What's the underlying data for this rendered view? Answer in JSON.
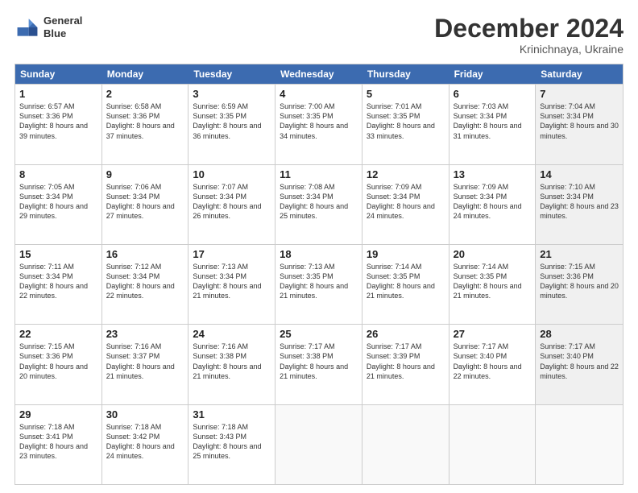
{
  "logo": {
    "line1": "General",
    "line2": "Blue"
  },
  "title": "December 2024",
  "subtitle": "Krinichnaya, Ukraine",
  "days_of_week": [
    "Sunday",
    "Monday",
    "Tuesday",
    "Wednesday",
    "Thursday",
    "Friday",
    "Saturday"
  ],
  "weeks": [
    [
      {
        "day": 1,
        "sunrise": "6:57 AM",
        "sunset": "3:36 PM",
        "daylight": "8 hours and 39 minutes.",
        "shaded": false
      },
      {
        "day": 2,
        "sunrise": "6:58 AM",
        "sunset": "3:36 PM",
        "daylight": "8 hours and 37 minutes.",
        "shaded": false
      },
      {
        "day": 3,
        "sunrise": "6:59 AM",
        "sunset": "3:35 PM",
        "daylight": "8 hours and 36 minutes.",
        "shaded": false
      },
      {
        "day": 4,
        "sunrise": "7:00 AM",
        "sunset": "3:35 PM",
        "daylight": "8 hours and 34 minutes.",
        "shaded": false
      },
      {
        "day": 5,
        "sunrise": "7:01 AM",
        "sunset": "3:35 PM",
        "daylight": "8 hours and 33 minutes.",
        "shaded": false
      },
      {
        "day": 6,
        "sunrise": "7:03 AM",
        "sunset": "3:34 PM",
        "daylight": "8 hours and 31 minutes.",
        "shaded": false
      },
      {
        "day": 7,
        "sunrise": "7:04 AM",
        "sunset": "3:34 PM",
        "daylight": "8 hours and 30 minutes.",
        "shaded": true
      }
    ],
    [
      {
        "day": 8,
        "sunrise": "7:05 AM",
        "sunset": "3:34 PM",
        "daylight": "8 hours and 29 minutes.",
        "shaded": false
      },
      {
        "day": 9,
        "sunrise": "7:06 AM",
        "sunset": "3:34 PM",
        "daylight": "8 hours and 27 minutes.",
        "shaded": false
      },
      {
        "day": 10,
        "sunrise": "7:07 AM",
        "sunset": "3:34 PM",
        "daylight": "8 hours and 26 minutes.",
        "shaded": false
      },
      {
        "day": 11,
        "sunrise": "7:08 AM",
        "sunset": "3:34 PM",
        "daylight": "8 hours and 25 minutes.",
        "shaded": false
      },
      {
        "day": 12,
        "sunrise": "7:09 AM",
        "sunset": "3:34 PM",
        "daylight": "8 hours and 24 minutes.",
        "shaded": false
      },
      {
        "day": 13,
        "sunrise": "7:09 AM",
        "sunset": "3:34 PM",
        "daylight": "8 hours and 24 minutes.",
        "shaded": false
      },
      {
        "day": 14,
        "sunrise": "7:10 AM",
        "sunset": "3:34 PM",
        "daylight": "8 hours and 23 minutes.",
        "shaded": true
      }
    ],
    [
      {
        "day": 15,
        "sunrise": "7:11 AM",
        "sunset": "3:34 PM",
        "daylight": "8 hours and 22 minutes.",
        "shaded": false
      },
      {
        "day": 16,
        "sunrise": "7:12 AM",
        "sunset": "3:34 PM",
        "daylight": "8 hours and 22 minutes.",
        "shaded": false
      },
      {
        "day": 17,
        "sunrise": "7:13 AM",
        "sunset": "3:34 PM",
        "daylight": "8 hours and 21 minutes.",
        "shaded": false
      },
      {
        "day": 18,
        "sunrise": "7:13 AM",
        "sunset": "3:35 PM",
        "daylight": "8 hours and 21 minutes.",
        "shaded": false
      },
      {
        "day": 19,
        "sunrise": "7:14 AM",
        "sunset": "3:35 PM",
        "daylight": "8 hours and 21 minutes.",
        "shaded": false
      },
      {
        "day": 20,
        "sunrise": "7:14 AM",
        "sunset": "3:35 PM",
        "daylight": "8 hours and 21 minutes.",
        "shaded": false
      },
      {
        "day": 21,
        "sunrise": "7:15 AM",
        "sunset": "3:36 PM",
        "daylight": "8 hours and 20 minutes.",
        "shaded": true
      }
    ],
    [
      {
        "day": 22,
        "sunrise": "7:15 AM",
        "sunset": "3:36 PM",
        "daylight": "8 hours and 20 minutes.",
        "shaded": false
      },
      {
        "day": 23,
        "sunrise": "7:16 AM",
        "sunset": "3:37 PM",
        "daylight": "8 hours and 21 minutes.",
        "shaded": false
      },
      {
        "day": 24,
        "sunrise": "7:16 AM",
        "sunset": "3:38 PM",
        "daylight": "8 hours and 21 minutes.",
        "shaded": false
      },
      {
        "day": 25,
        "sunrise": "7:17 AM",
        "sunset": "3:38 PM",
        "daylight": "8 hours and 21 minutes.",
        "shaded": false
      },
      {
        "day": 26,
        "sunrise": "7:17 AM",
        "sunset": "3:39 PM",
        "daylight": "8 hours and 21 minutes.",
        "shaded": false
      },
      {
        "day": 27,
        "sunrise": "7:17 AM",
        "sunset": "3:40 PM",
        "daylight": "8 hours and 22 minutes.",
        "shaded": false
      },
      {
        "day": 28,
        "sunrise": "7:17 AM",
        "sunset": "3:40 PM",
        "daylight": "8 hours and 22 minutes.",
        "shaded": true
      }
    ],
    [
      {
        "day": 29,
        "sunrise": "7:18 AM",
        "sunset": "3:41 PM",
        "daylight": "8 hours and 23 minutes.",
        "shaded": false
      },
      {
        "day": 30,
        "sunrise": "7:18 AM",
        "sunset": "3:42 PM",
        "daylight": "8 hours and 24 minutes.",
        "shaded": false
      },
      {
        "day": 31,
        "sunrise": "7:18 AM",
        "sunset": "3:43 PM",
        "daylight": "8 hours and 25 minutes.",
        "shaded": false
      },
      null,
      null,
      null,
      null
    ]
  ],
  "labels": {
    "sunrise": "Sunrise:",
    "sunset": "Sunset:",
    "daylight": "Daylight:"
  }
}
